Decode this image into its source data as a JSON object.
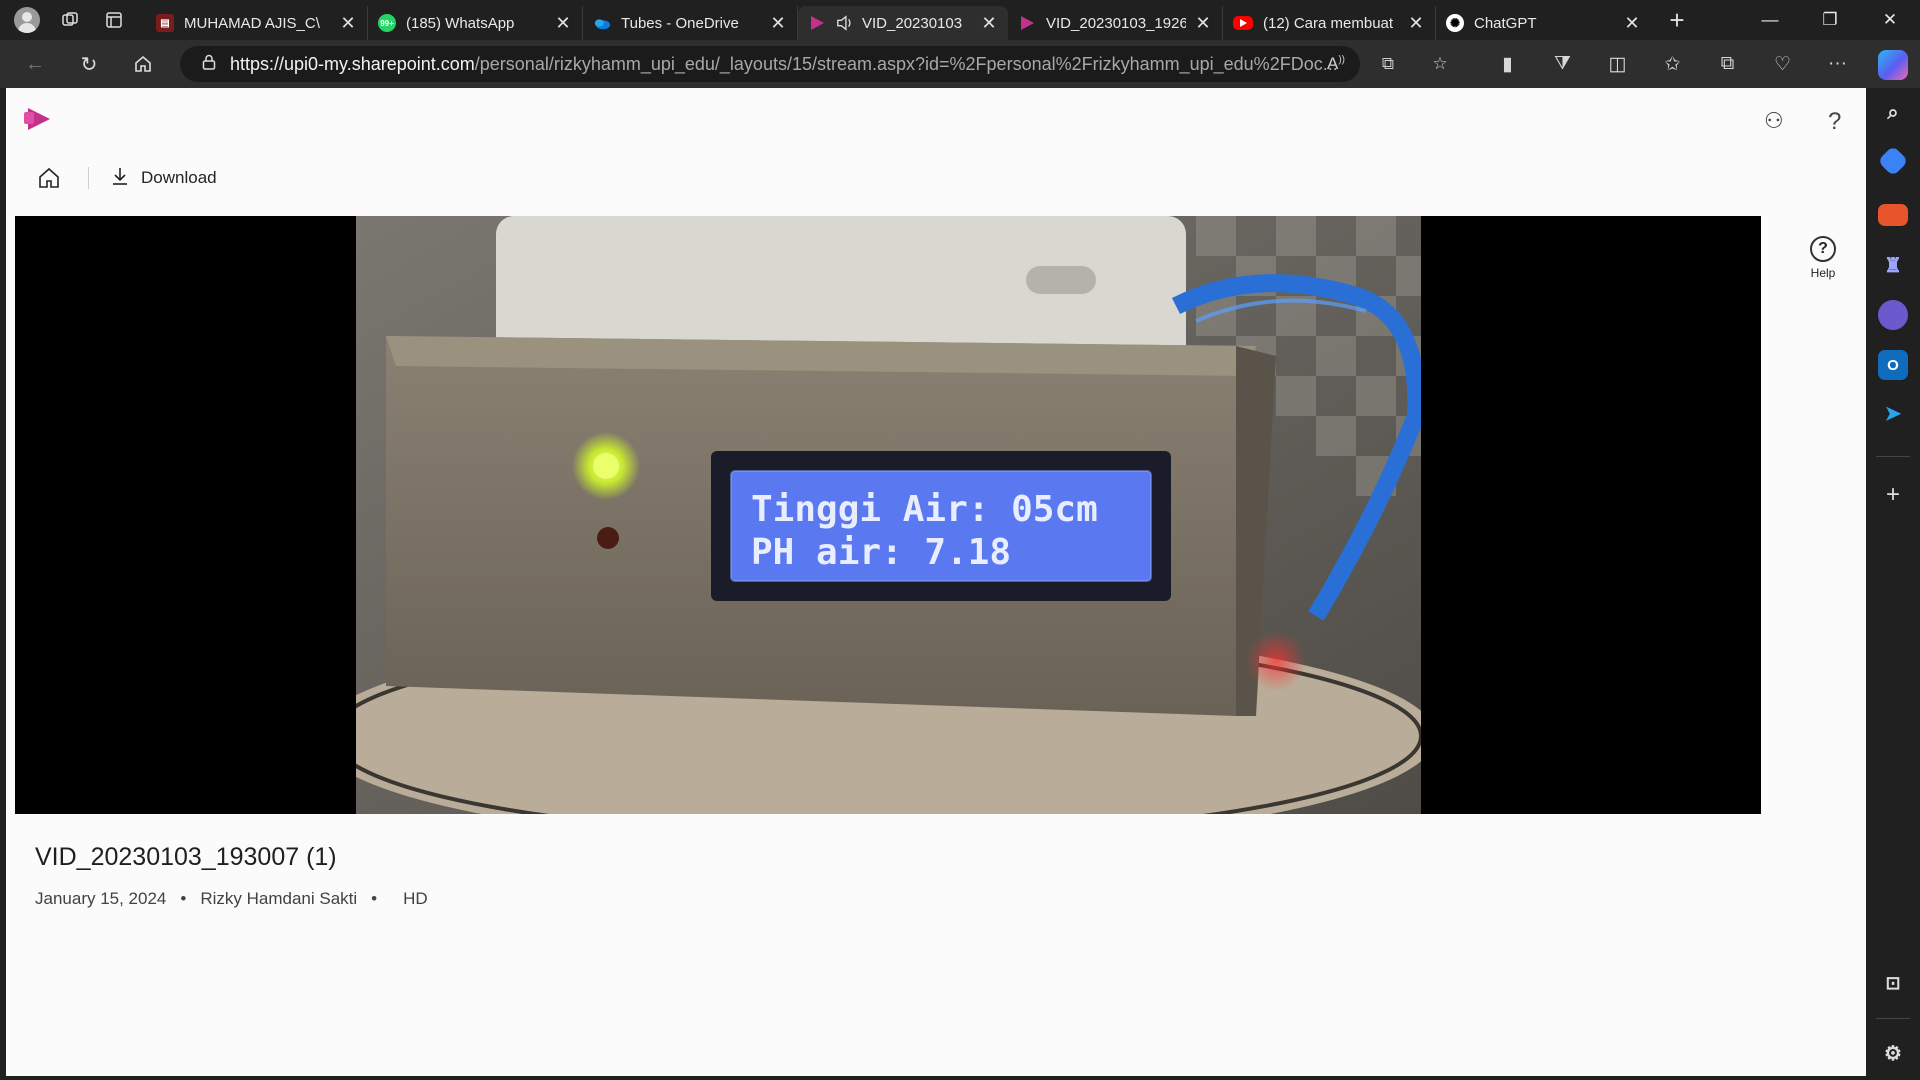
{
  "browser": {
    "tabs": [
      {
        "title": "MUHAMAD AJIS_C\\",
        "icon": "pdf-icon",
        "color": "#c42b1c",
        "active": false
      },
      {
        "title": "(185) WhatsApp",
        "icon": "whatsapp-icon",
        "color": "#25d366",
        "badge": "99+",
        "active": false
      },
      {
        "title": "Tubes - OneDrive",
        "icon": "onedrive-icon",
        "color": "#0a7de0",
        "active": false
      },
      {
        "title": "VID_20230103",
        "icon": "stream-icon",
        "color": "#c4318a",
        "active": true,
        "audio": true
      },
      {
        "title": "VID_20230103_1926",
        "icon": "stream-icon",
        "color": "#c4318a",
        "active": false
      },
      {
        "title": "(12) Cara membuat",
        "icon": "youtube-icon",
        "color": "#ff0000",
        "active": false
      },
      {
        "title": "ChatGPT",
        "icon": "chatgpt-icon",
        "color": "#ffffff",
        "active": false
      }
    ],
    "url_host": "https://upi0-my.sharepoint.com",
    "url_path": "/personal/rizkyhamm_upi_edu/_layouts/15/stream.aspx?id=%2Fpersonal%2Frizkyhamm_upi_edu%2FDoc..."
  },
  "page": {
    "download_label": "Download",
    "help_label": "Help",
    "video_title": "VID_20230103_193007 (1)",
    "date": "January 15, 2024",
    "separator": "•",
    "author": "Rizky Hamdani Sakti",
    "quality": "HD"
  },
  "video_frame": {
    "lcd_line1": "Tinggi Air: 05cm",
    "lcd_line2": "PH air: 7.18",
    "lcd_color": "#5a78f0"
  }
}
